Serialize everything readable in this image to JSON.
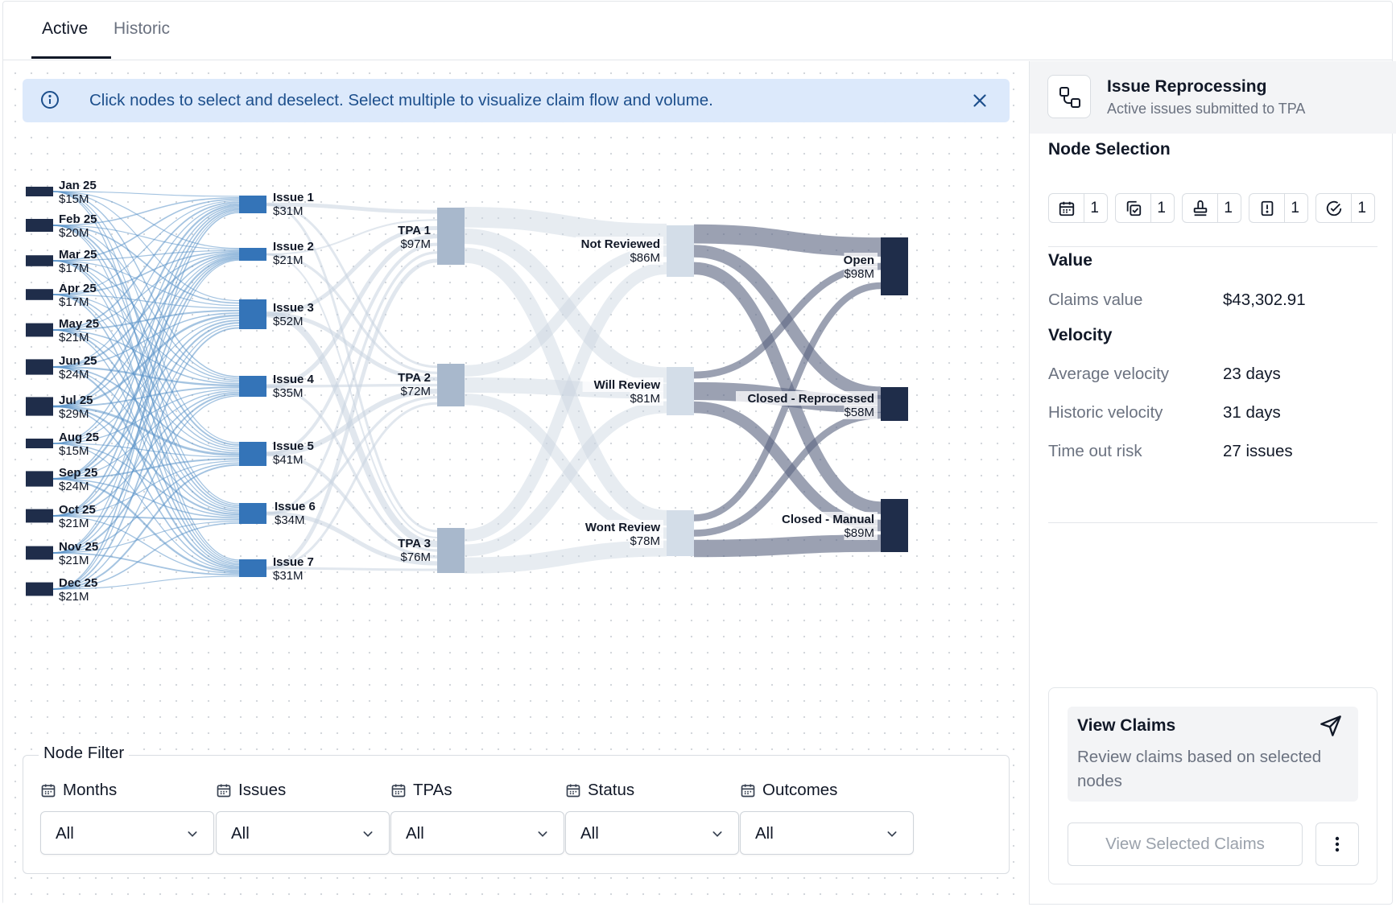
{
  "tabs": [
    {
      "label": "Active"
    },
    {
      "label": "Historic"
    }
  ],
  "banner": {
    "text": "Click nodes to select and deselect. Select multiple to visualize claim flow and volume."
  },
  "colors": {
    "month_node": "#1f2d4a",
    "issue_node": "#3474b8",
    "tpa_node": "#a8b8cc",
    "status_node": "#d3dde8",
    "outcome_node": "#1f2d4a",
    "month_link": "#5b94c9",
    "mid_link": "#c9d4e0",
    "outcome_link": "#5d6883"
  },
  "sankey": {
    "months": [
      {
        "name": "Jan 25",
        "value": "$15M"
      },
      {
        "name": "Feb 25",
        "value": "$20M"
      },
      {
        "name": "Mar 25",
        "value": "$17M"
      },
      {
        "name": "Apr 25",
        "value": "$17M"
      },
      {
        "name": "May 25",
        "value": "$21M"
      },
      {
        "name": "Jun 25",
        "value": "$24M"
      },
      {
        "name": "Jul 25",
        "value": "$29M"
      },
      {
        "name": "Aug 25",
        "value": "$15M"
      },
      {
        "name": "Sep 25",
        "value": "$24M"
      },
      {
        "name": "Oct 25",
        "value": "$21M"
      },
      {
        "name": "Nov 25",
        "value": "$21M"
      },
      {
        "name": "Dec 25",
        "value": "$21M"
      }
    ],
    "issues": [
      {
        "name": "Issue 1",
        "value": "$31M"
      },
      {
        "name": "Issue 2",
        "value": "$21M"
      },
      {
        "name": "Issue 3",
        "value": "$52M"
      },
      {
        "name": "Issue 4",
        "value": "$35M"
      },
      {
        "name": "Issue 5",
        "value": "$41M"
      },
      {
        "name": "Issue 6",
        "value": "$34M"
      },
      {
        "name": "Issue 7",
        "value": "$31M"
      }
    ],
    "tpas": [
      {
        "name": "TPA 1",
        "value": "$97M"
      },
      {
        "name": "TPA 2",
        "value": "$72M"
      },
      {
        "name": "TPA 3",
        "value": "$76M"
      }
    ],
    "statuses": [
      {
        "name": "Not Reviewed",
        "value": "$86M"
      },
      {
        "name": "Will Review",
        "value": "$81M"
      },
      {
        "name": "Wont Review",
        "value": "$78M"
      }
    ],
    "outcomes": [
      {
        "name": "Open",
        "value": "$98M"
      },
      {
        "name": "Closed - Reprocessed",
        "value": "$58M"
      },
      {
        "name": "Closed - Manual",
        "value": "$89M"
      }
    ]
  },
  "filter": {
    "legend": "Node Filter",
    "columns": [
      {
        "label": "Months",
        "value": "All"
      },
      {
        "label": "Issues",
        "value": "All"
      },
      {
        "label": "TPAs",
        "value": "All"
      },
      {
        "label": "Status",
        "value": "All"
      },
      {
        "label": "Outcomes",
        "value": "All"
      }
    ]
  },
  "panel": {
    "title": "Issue Reprocessing",
    "subtitle": "Active issues submitted to TPA",
    "node_selection_title": "Node Selection",
    "chips": [
      {
        "icon": "calendar-icon",
        "count": "1"
      },
      {
        "icon": "copy-check-icon",
        "count": "1"
      },
      {
        "icon": "stamp-icon",
        "count": "1"
      },
      {
        "icon": "alert-file-icon",
        "count": "1"
      },
      {
        "icon": "check-circle-icon",
        "count": "1"
      }
    ],
    "value_title": "Value",
    "claims_value_label": "Claims value",
    "claims_value": "$43,302.91",
    "velocity_title": "Velocity",
    "velocity": [
      {
        "label": "Average velocity",
        "value": "23 days"
      },
      {
        "label": "Historic velocity",
        "value": "31 days"
      },
      {
        "label": "Time out risk",
        "value": "27 issues"
      }
    ],
    "card": {
      "title": "View Claims",
      "desc": "Review claims based on selected nodes",
      "button": "View Selected Claims"
    }
  }
}
